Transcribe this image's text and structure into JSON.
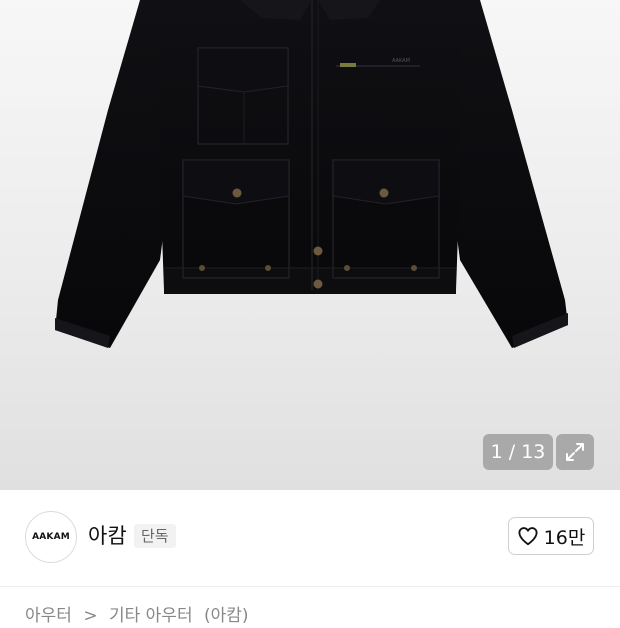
{
  "gallery": {
    "counter": "1 / 13",
    "expand_icon": "expand-icon",
    "background": "#ececec",
    "product_color": "#0b0b0d"
  },
  "brand": {
    "logo_text": "AAKAM",
    "name": "아캄",
    "badge": "단독"
  },
  "like": {
    "icon": "heart-icon",
    "count": "16만"
  },
  "breadcrumb": {
    "items": [
      "아우터",
      "기타 아우터",
      "(아캄)"
    ],
    "separator": ">"
  }
}
